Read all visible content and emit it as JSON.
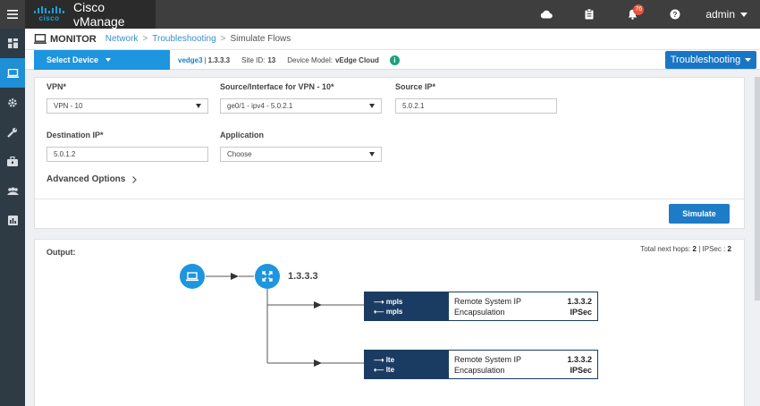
{
  "app": {
    "brand": "Cisco vManage",
    "logo_text": "cisco"
  },
  "topbar": {
    "icons": [
      "cloud-icon",
      "clipboard-icon",
      "bell-icon",
      "help-icon"
    ],
    "bell_count": "76",
    "user": "admin"
  },
  "sidebar": {
    "items": [
      "dashboard-icon",
      "monitor-icon",
      "configuration-icon",
      "tools-icon",
      "maintenance-icon",
      "administration-icon",
      "analytics-icon"
    ],
    "active": "monitor-icon"
  },
  "header": {
    "section": "MONITOR",
    "breadcrumb": [
      "Network",
      "Troubleshooting",
      "Simulate Flows"
    ],
    "separator": ">"
  },
  "device_bar": {
    "select_label": "Select Device",
    "device_name": "vedge3",
    "system_ip": "1.3.3.3",
    "site_label": "Site ID:",
    "site_id": "13",
    "model_label": "Device Model:",
    "model": "vEdge Cloud",
    "troubleshooting_label": "Troubleshooting"
  },
  "form": {
    "vpn_label": "VPN*",
    "vpn_value": "VPN - 10",
    "source_iface_label": "Source/Interface for VPN - 10*",
    "source_iface_value": "ge0/1 - ipv4 - 5.0.2.1",
    "source_ip_label": "Source IP*",
    "source_ip_value": "5.0.2.1",
    "dest_ip_label": "Destination IP*",
    "dest_ip_value": "5.0.1.2",
    "application_label": "Application",
    "application_value": "Choose",
    "advanced_label": "Advanced Options",
    "simulate_label": "Simulate"
  },
  "output": {
    "label": "Output:",
    "hops_label": "Total next hops:",
    "hops_count": "2",
    "ipsec_label": "IPSec :",
    "ipsec_count": "2",
    "device_ip": "1.3.3.3",
    "hops": [
      {
        "out_iface": "mpls",
        "in_iface": "mpls",
        "remote_label": "Remote System IP",
        "remote_ip": "1.3.3.2",
        "encap_label": "Encapsulation",
        "encap": "IPSec"
      },
      {
        "out_iface": "lte",
        "in_iface": "lte",
        "remote_label": "Remote System IP",
        "remote_ip": "1.3.3.2",
        "encap_label": "Encapsulation",
        "encap": "IPSec"
      }
    ]
  },
  "colors": {
    "topbar": "#3e3e3e",
    "sidebar": "#2e3a44",
    "accent": "#1d95df",
    "hop_box": "#1b3c62",
    "badge": "#e8543b"
  }
}
